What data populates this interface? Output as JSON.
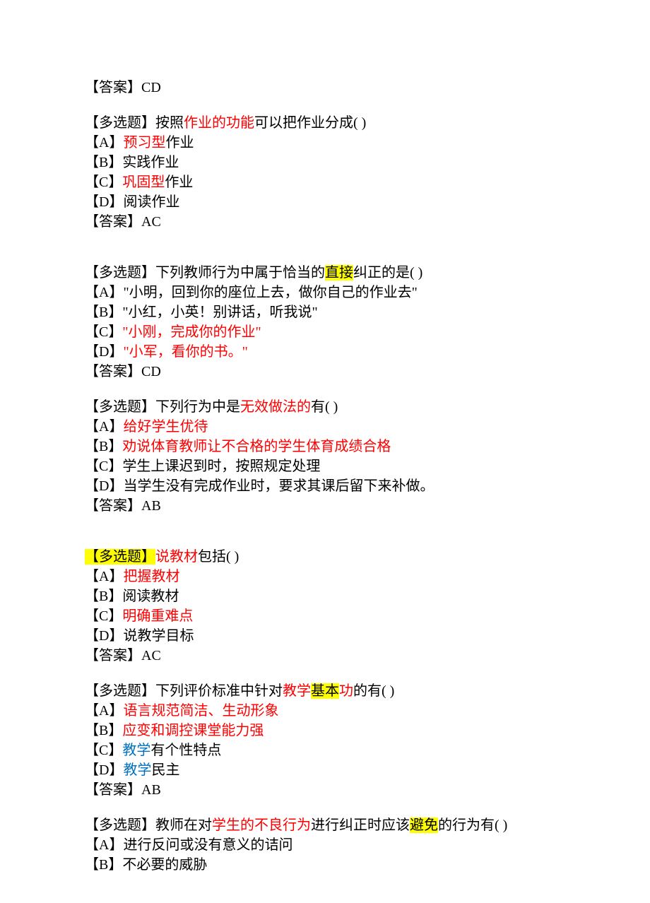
{
  "q0": {
    "answer_label": "【答案】",
    "answer_value": "CD"
  },
  "q1": {
    "tag": "【多选题】",
    "stem1": "按照",
    "stem2_red": "作业的功能",
    "stem3": "可以把作业分成( )",
    "optA_pre": "【A】",
    "optA_red": "预习型",
    "optA_post": "作业",
    "optB": "【B】实践作业",
    "optC_pre": "【C】",
    "optC_red": "巩固型",
    "optC_post": "作业",
    "optD": "【D】阅读作业",
    "answer_label": "【答案】",
    "answer_value": "AC"
  },
  "q2": {
    "tag": "【多选题】",
    "stem1": "下列教师行为中属于恰当的",
    "stem2_hl": "直接",
    "stem3": "纠正的是( )",
    "optA": "【A】\"小明，回到你的座位上去，做你自己的作业去\"",
    "optB": "【B】\"小红，小英！别讲话，听我说\"",
    "optC_pre": "【C】",
    "optC_red": "\"小刚，完成你的作业\"",
    "optD_pre": "【D】",
    "optD_red": "\"小军，看你的书。\"",
    "answer_label": "【答案】",
    "answer_value": "CD"
  },
  "q3": {
    "tag": "【多选题】",
    "stem1": "下列行为中是",
    "stem2_red": "无效做法的",
    "stem3": "有( )",
    "optA_pre": "【A】",
    "optA_red": "给好学生优待",
    "optB_pre": "【B】",
    "optB_red": "劝说体育教师让不合格的学生体育成绩合格",
    "optC": "【C】学生上课迟到时，按照规定处理",
    "optD": "【D】当学生没有完成作业时，要求其课后留下来补做。",
    "answer_label": "【答案】",
    "answer_value": "AB"
  },
  "q4": {
    "tag_hl": "【多选题】",
    "stem1_red": "说教材",
    "stem2": "包括( )",
    "optA_pre": "【A】",
    "optA_red": "把握教材",
    "optB": "【B】阅读教材",
    "optC_pre": "【C】",
    "optC_red": "明确重难点",
    "optD": "【D】说教学目标",
    "answer_label": "【答案】",
    "answer_value": "AC"
  },
  "q5": {
    "tag": "【多选题】",
    "stem1": "下列评价标准中针对",
    "stem2_red": "教学",
    "stem3_hl": "基本",
    "stem4_red": "功",
    "stem5": "的有( )",
    "optA_pre": "【A】",
    "optA_red": "语言规范简洁、生动形象",
    "optB_pre": "【B】",
    "optB_red": "应变和调控课堂能力强",
    "optC_pre": "【C】",
    "optC_blue": "教学",
    "optC_post": "有个性特点",
    "optD_pre": "【D】",
    "optD_blue": "教学",
    "optD_post": "民主",
    "answer_label": "【答案】",
    "answer_value": "AB"
  },
  "q6": {
    "tag": "【多选题】",
    "stem1": "教师在对",
    "stem2_red": "学生的不良行为",
    "stem3": "进行纠正时应该",
    "stem4_hl": "避免",
    "stem5": "的行为有( )",
    "optA": "【A】进行反问或没有意义的诘问",
    "optB": "【B】不必要的威胁"
  }
}
